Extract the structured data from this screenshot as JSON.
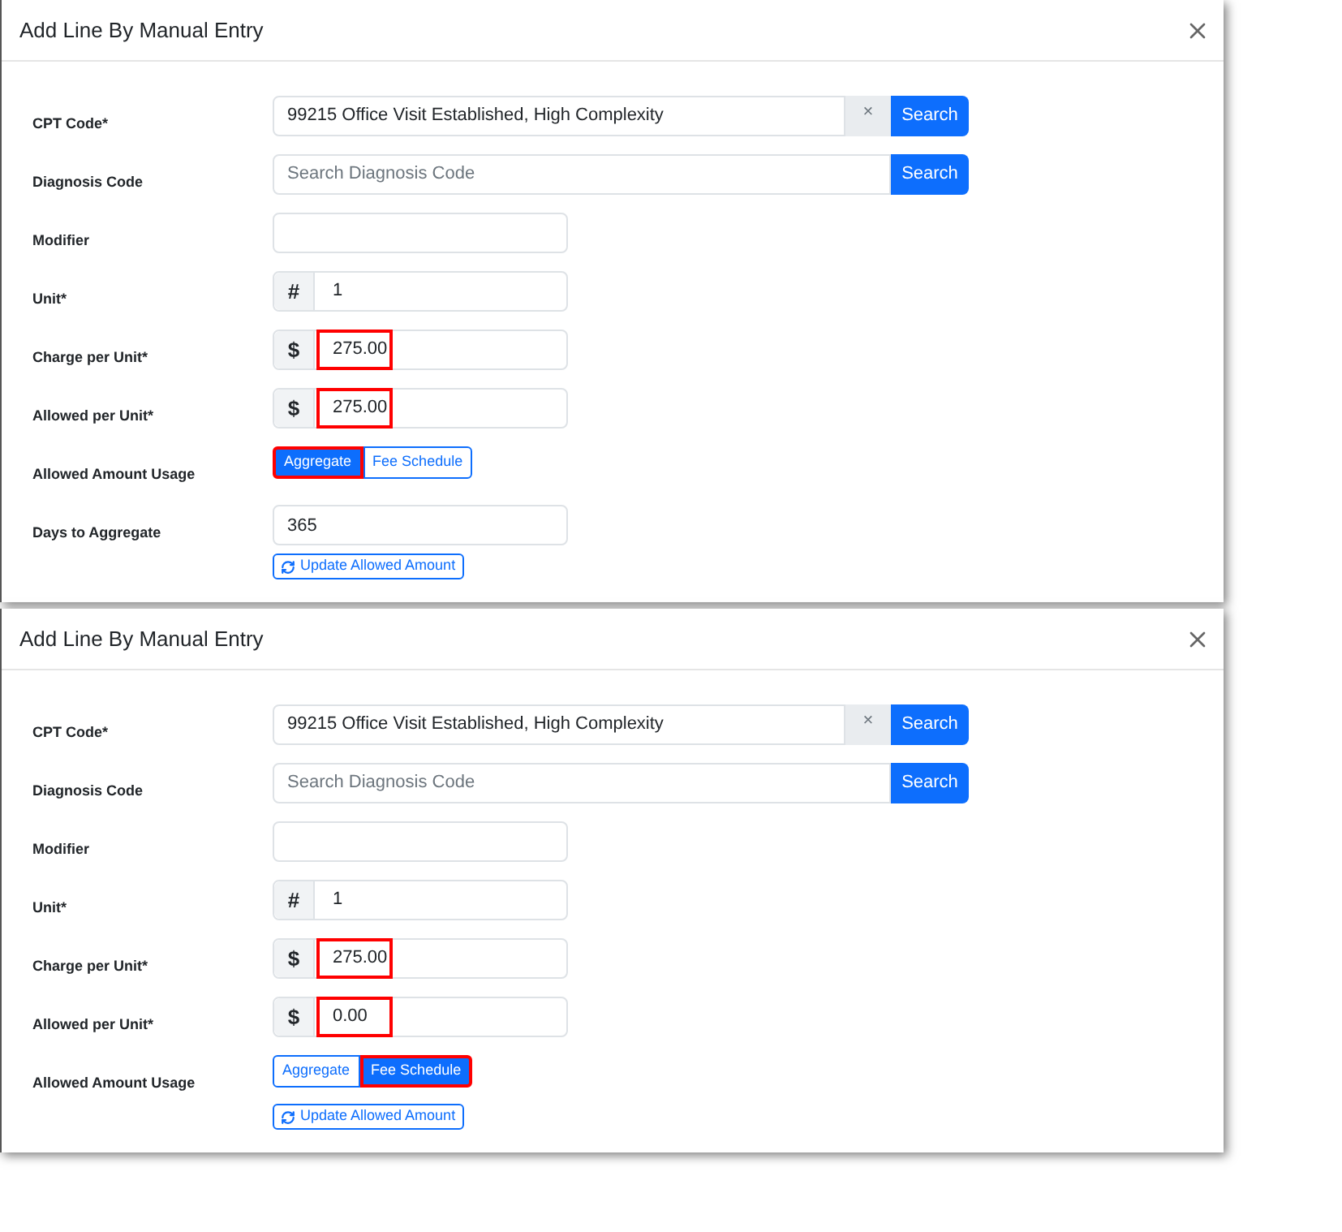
{
  "panels": [
    {
      "title": "Add Line By Manual Entry",
      "fields": [
        {
          "kind": "search",
          "label": "CPT Code*",
          "value": "99215 Office Visit Established, High Complexity",
          "clear": "×",
          "button": "Search"
        },
        {
          "kind": "search",
          "label": "Diagnosis Code",
          "placeholder": "Search Diagnosis Code",
          "button": "Search"
        },
        {
          "kind": "text",
          "label": "Modifier"
        },
        {
          "kind": "prefixed",
          "label": "Unit*",
          "prefix": "#",
          "value": "1",
          "highlighted": false
        },
        {
          "kind": "prefixed",
          "label": "Charge per Unit*",
          "prefix": "$",
          "value": "275.00",
          "highlighted": true
        },
        {
          "kind": "prefixed",
          "label": "Allowed per Unit*",
          "prefix": "$",
          "value": "275.00",
          "highlighted": true
        },
        {
          "kind": "toggle",
          "label": "Allowed Amount Usage",
          "options": [
            {
              "label": "Aggregate",
              "selected": true,
              "highlighted": true
            },
            {
              "label": "Fee Schedule",
              "selected": false,
              "highlighted": false
            }
          ]
        },
        {
          "kind": "text",
          "label": "Days to Aggregate",
          "value": "365"
        },
        {
          "kind": "action",
          "button": "Update Allowed Amount"
        }
      ]
    },
    {
      "title": "Add Line By Manual Entry",
      "fields": [
        {
          "kind": "search",
          "label": "CPT Code*",
          "value": "99215 Office Visit Established, High Complexity",
          "clear": "×",
          "button": "Search"
        },
        {
          "kind": "search",
          "label": "Diagnosis Code",
          "placeholder": "Search Diagnosis Code",
          "button": "Search"
        },
        {
          "kind": "text",
          "label": "Modifier"
        },
        {
          "kind": "prefixed",
          "label": "Unit*",
          "prefix": "#",
          "value": "1",
          "highlighted": false
        },
        {
          "kind": "prefixed",
          "label": "Charge per Unit*",
          "prefix": "$",
          "value": "275.00",
          "highlighted": true
        },
        {
          "kind": "prefixed",
          "label": "Allowed per Unit*",
          "prefix": "$",
          "value": "0.00",
          "highlighted": true
        },
        {
          "kind": "toggle",
          "label": "Allowed Amount Usage",
          "options": [
            {
              "label": "Aggregate",
              "selected": false,
              "highlighted": false
            },
            {
              "label": "Fee Schedule",
              "selected": true,
              "highlighted": true
            }
          ]
        },
        {
          "kind": "action",
          "button": "Update Allowed Amount"
        }
      ]
    }
  ]
}
